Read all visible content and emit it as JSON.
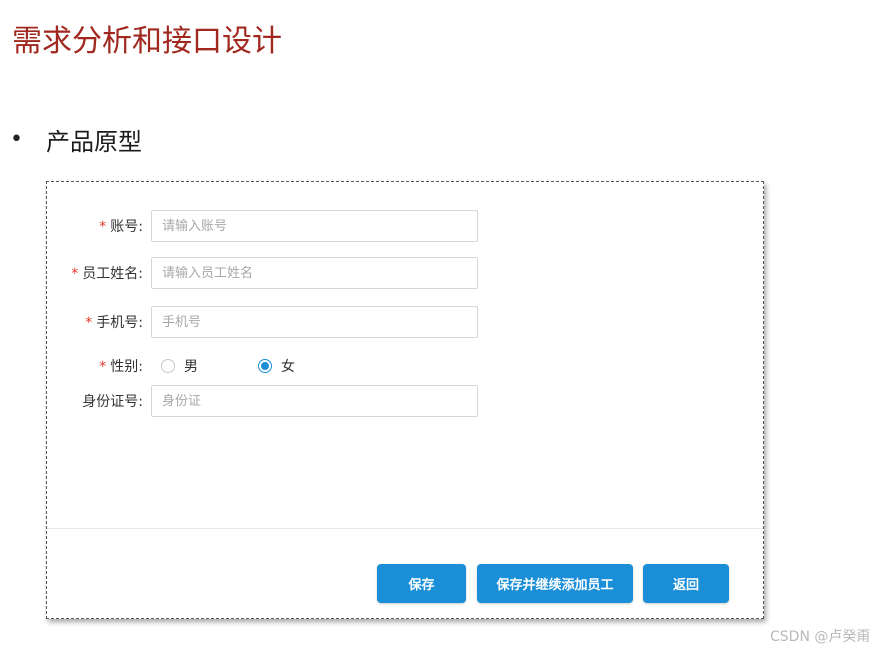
{
  "slide": {
    "title": "需求分析和接口设计",
    "bullet": "产品原型"
  },
  "form": {
    "fields": [
      {
        "label": "账号:",
        "required": true,
        "placeholder": "请输入账号"
      },
      {
        "label": "员工姓名:",
        "required": true,
        "placeholder": "请输入员工姓名"
      },
      {
        "label": "手机号:",
        "required": true,
        "placeholder": "手机号"
      },
      {
        "label": "身份证号:",
        "required": false,
        "placeholder": "身份证"
      }
    ],
    "gender": {
      "label": "性别:",
      "required": true,
      "options": [
        {
          "label": "男",
          "checked": false
        },
        {
          "label": "女",
          "checked": true
        }
      ]
    },
    "required_mark": "*"
  },
  "actions": {
    "save": "保存",
    "save_continue": "保存并继续添加员工",
    "back": "返回"
  },
  "watermark": "CSDN @卢癸甭",
  "colors": {
    "title": "#a0281e",
    "primary": "#1a8fd8",
    "required": "#e0352c"
  }
}
